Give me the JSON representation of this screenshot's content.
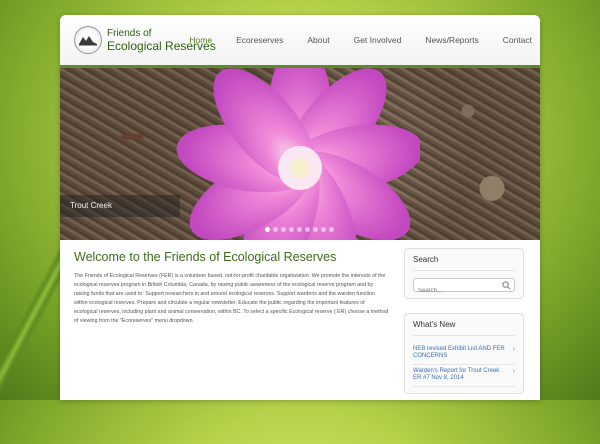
{
  "site": {
    "logo_line1": "Friends of",
    "logo_line2": "Ecological Reserves"
  },
  "nav": [
    {
      "label": "Home",
      "active": true
    },
    {
      "label": "Ecoreserves",
      "active": false
    },
    {
      "label": "About",
      "active": false
    },
    {
      "label": "Get Involved",
      "active": false
    },
    {
      "label": "News/Reports",
      "active": false
    },
    {
      "label": "Contact",
      "active": false
    }
  ],
  "slider": {
    "caption": "Trout Creek",
    "dot_count": 9,
    "active_dot": 0
  },
  "main": {
    "title": "Welcome to the Friends of Ecological Reserves",
    "body": "The Friends of Ecological Reserves (FER) is a volunteer based, not-for-profit charitable organization. We promote the interests of the ecological reserves program in British Columbia, Canada, by raising public awareness of the ecological reserve program and by raising funds that are used to: Support researchers in and around ecological reserves. Support wardens and the warden function within ecological reserves. Prepare and circulate a regular newsletter. Educate the public regarding the important features of ecological reserves, including plant and animal conservation, within BC. To select a specific Ecological reserve ( ER) choose a method of viewing from the \"Ecoreserves\" menu dropdown."
  },
  "sidebar": {
    "search_title": "Search",
    "search_placeholder": "Search…",
    "news_title": "What's New",
    "news": [
      "NEB revised Exhibit List AND FER CONCERNS",
      "Warden's Report for Trout Creek ER #7 Nov 8, 2014"
    ]
  },
  "colors": {
    "accent_green": "#4d7d1d",
    "link_blue": "#3b6fb0"
  }
}
